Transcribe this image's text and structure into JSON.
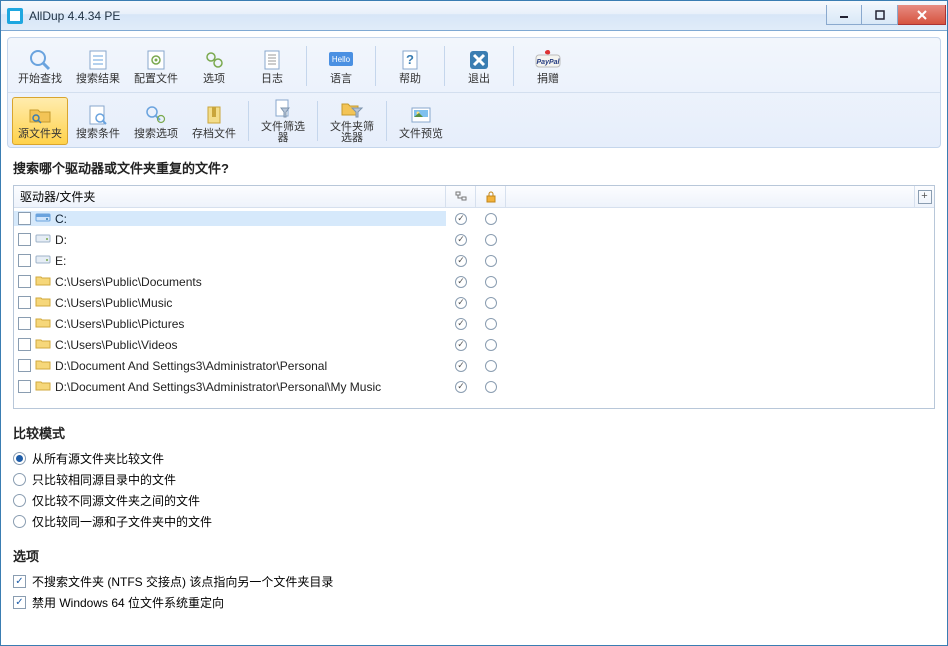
{
  "title": "AllDup 4.4.34 PE",
  "toolbar1": [
    {
      "id": "start-search",
      "label": "开始查找"
    },
    {
      "id": "search-results",
      "label": "搜索结果"
    },
    {
      "id": "config-file",
      "label": "配置文件"
    },
    {
      "id": "options",
      "label": "选项"
    },
    {
      "id": "log",
      "label": "日志"
    },
    {
      "sep": true
    },
    {
      "id": "language",
      "label": "语言"
    },
    {
      "sep": true
    },
    {
      "id": "help",
      "label": "帮助"
    },
    {
      "sep": true
    },
    {
      "id": "exit",
      "label": "退出"
    },
    {
      "sep": true
    },
    {
      "id": "donate",
      "label": "捐赠"
    }
  ],
  "toolbar2": [
    {
      "id": "source-folder",
      "label": "源文件夹",
      "selected": true
    },
    {
      "id": "search-criteria",
      "label": "搜索条件"
    },
    {
      "id": "search-options",
      "label": "搜索选项"
    },
    {
      "id": "archive-file",
      "label": "存档文件"
    },
    {
      "sep": true
    },
    {
      "id": "file-filter",
      "label": "文件筛选器"
    },
    {
      "sep": true
    },
    {
      "id": "folder-filter",
      "label": "文件夹筛选器"
    },
    {
      "sep": true
    },
    {
      "id": "file-preview",
      "label": "文件预览"
    }
  ],
  "question": "搜索哪个驱动器或文件夹重复的文件?",
  "list": {
    "header_path": "驱动器/文件夹",
    "rows": [
      {
        "type": "drive",
        "text": "C:",
        "selected": true,
        "a": true,
        "b": false
      },
      {
        "type": "drive",
        "text": "D:",
        "a": true,
        "b": false
      },
      {
        "type": "drive",
        "text": "E:",
        "a": true,
        "b": false
      },
      {
        "type": "folder",
        "text": "C:\\Users\\Public\\Documents",
        "a": true,
        "b": false
      },
      {
        "type": "folder",
        "text": "C:\\Users\\Public\\Music",
        "a": true,
        "b": false
      },
      {
        "type": "folder",
        "text": "C:\\Users\\Public\\Pictures",
        "a": true,
        "b": false
      },
      {
        "type": "folder",
        "text": "C:\\Users\\Public\\Videos",
        "a": true,
        "b": false
      },
      {
        "type": "folder",
        "text": "D:\\Document And Settings3\\Administrator\\Personal",
        "a": true,
        "b": false
      },
      {
        "type": "folder",
        "text": "D:\\Document And Settings3\\Administrator\\Personal\\My Music",
        "a": true,
        "b": false
      }
    ]
  },
  "compare": {
    "title": "比较模式",
    "options": [
      {
        "text": "从所有源文件夹比较文件",
        "checked": true
      },
      {
        "text": "只比较相同源目录中的文件",
        "checked": false
      },
      {
        "text": "仅比较不同源文件夹之间的文件",
        "checked": false
      },
      {
        "text": "仅比较同一源和子文件夹中的文件",
        "checked": false
      }
    ]
  },
  "opts": {
    "title": "选项",
    "items": [
      {
        "text": "不搜索文件夹 (NTFS 交接点) 该点指向另一个文件夹目录",
        "checked": true
      },
      {
        "text": "禁用 Windows 64 位文件系统重定向",
        "checked": true
      }
    ]
  }
}
